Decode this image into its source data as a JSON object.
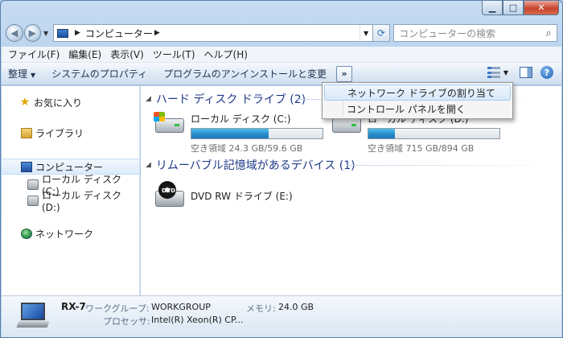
{
  "address": {
    "breadcrumb": "コンピューター",
    "search_placeholder": "コンピューターの検索"
  },
  "menu": [
    "ファイル(F)",
    "編集(E)",
    "表示(V)",
    "ツール(T)",
    "ヘルプ(H)"
  ],
  "commands": {
    "organize": "整理",
    "system_properties": "システムのプロパティ",
    "uninstall": "プログラムのアンインストールと変更",
    "more": "»"
  },
  "popup": {
    "items": [
      "ネットワーク ドライブの割り当て",
      "コントロール パネルを開く"
    ]
  },
  "nav": {
    "favorites": "お気に入り",
    "libraries": "ライブラリ",
    "computer": "コンピューター",
    "drive_c": "ローカル ディスク (C:)",
    "drive_d": "ローカル ディスク (D:)",
    "network": "ネットワーク"
  },
  "groups": {
    "hdd": "ハード ディスク ドライブ (2)",
    "removable": "リムーバブル記憶域があるデバイス (1)"
  },
  "drives": [
    {
      "name": "ローカル ディスク (C:)",
      "free": "空き領域 24.3 GB/59.6 GB",
      "used_fraction": 0.59
    },
    {
      "name": "ローカル ディスク (D:)",
      "free": "空き領域 715 GB/894 GB",
      "used_fraction": 0.2
    }
  ],
  "dvd": {
    "name": "DVD RW ドライブ (E:)",
    "badge": "DVD"
  },
  "details": {
    "name": "RX-7",
    "workgroup_label": "ワークグループ:",
    "workgroup": "WORKGROUP",
    "memory_label": "メモリ:",
    "memory": "24.0 GB",
    "processor_label": "プロセッサ:",
    "processor": "Intel(R) Xeon(R) CP..."
  }
}
